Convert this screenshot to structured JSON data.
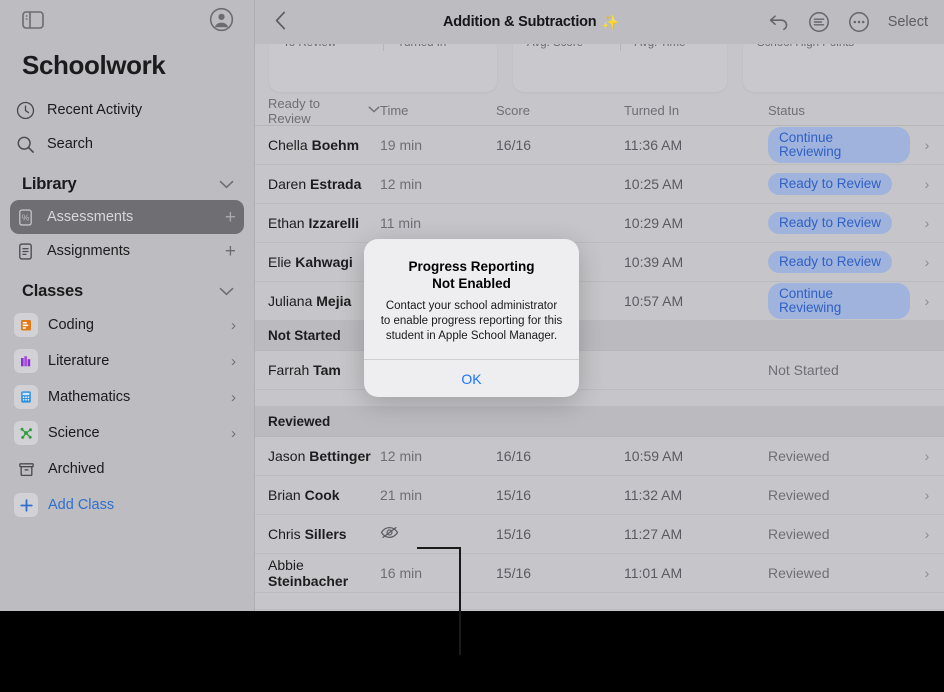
{
  "sidebar": {
    "toggle_icon": "sidebar-toggle-icon",
    "account_icon": "account-circle-icon",
    "app_title": "Schoolwork",
    "nav": [
      {
        "label": "Recent Activity",
        "icon": "clock-icon"
      },
      {
        "label": "Search",
        "icon": "search-icon"
      }
    ],
    "library": {
      "title": "Library",
      "items": [
        {
          "label": "Assessments",
          "icon": "assessments-icon",
          "selected": true,
          "add": "+"
        },
        {
          "label": "Assignments",
          "icon": "assignments-icon",
          "selected": false,
          "add": "+"
        }
      ]
    },
    "classes": {
      "title": "Classes",
      "items": [
        {
          "label": "Coding",
          "icon": "coding-icon",
          "chevron": "›"
        },
        {
          "label": "Literature",
          "icon": "literature-icon",
          "chevron": "›"
        },
        {
          "label": "Mathematics",
          "icon": "calculator-icon",
          "chevron": "›"
        },
        {
          "label": "Science",
          "icon": "molecule-icon",
          "chevron": "›"
        },
        {
          "label": "Archived",
          "icon": "archive-box-icon",
          "chevron": ""
        },
        {
          "label": "Add Class",
          "icon": "plus-icon",
          "chevron": ""
        }
      ]
    }
  },
  "toolbar": {
    "back_icon": "chevron-left-icon",
    "title": "Addition & Subtraction",
    "title_sparkle": "✨",
    "undo_icon": "undo-arrow-icon",
    "notes_icon": "text-lines-circle-icon",
    "more_icon": "ellipsis-circle-icon",
    "select_label": "Select"
  },
  "cards": [
    {
      "metrics": [
        "To Review",
        "Turned In"
      ]
    },
    {
      "metrics": [
        "Avg. Score",
        "Avg. Time"
      ]
    },
    {
      "metrics": [
        "School High Points"
      ]
    }
  ],
  "table": {
    "columns": {
      "name": "Ready to Review",
      "sort_chevron": "⌄",
      "time": "Time",
      "score": "Score",
      "turned_in": "Turned In",
      "status": "Status"
    },
    "rows": [
      {
        "first": "Chella ",
        "last": "Boehm",
        "time": "19 min",
        "score": "16/16",
        "turned_in": "11:36 AM",
        "status": "Continue Reviewing",
        "status_kind": "pill",
        "arrow": "›"
      },
      {
        "first": "Daren ",
        "last": "Estrada",
        "time": "12 min",
        "score": "",
        "turned_in": "10:25 AM",
        "status": "Ready to Review",
        "status_kind": "pill",
        "arrow": "›"
      },
      {
        "first": "Ethan ",
        "last": "Izzarelli",
        "time": "11 min",
        "score": "",
        "turned_in": "10:29 AM",
        "status": "Ready to Review",
        "status_kind": "pill",
        "arrow": "›"
      },
      {
        "first": "Elie ",
        "last": "Kahwagi",
        "time": "",
        "score": "",
        "turned_in": "10:39 AM",
        "status": "Ready to Review",
        "status_kind": "pill",
        "arrow": "›"
      },
      {
        "first": "Juliana ",
        "last": "Mejia",
        "time": "",
        "score": "",
        "turned_in": "10:57 AM",
        "status": "Continue Reviewing",
        "status_kind": "pill",
        "arrow": "›"
      }
    ],
    "section_not_started": {
      "title": "Not Started",
      "rows": [
        {
          "first": "Farrah ",
          "last": "Tam",
          "time": "",
          "score": "",
          "turned_in": "",
          "status": "Not Started",
          "status_kind": "text",
          "arrow": ""
        }
      ]
    },
    "section_reviewed": {
      "title": "Reviewed",
      "rows": [
        {
          "first": "Jason ",
          "last": "Bettinger",
          "time": "12 min",
          "score": "16/16",
          "turned_in": "10:59 AM",
          "status": "Reviewed",
          "status_kind": "text",
          "arrow": "›"
        },
        {
          "first": "Brian ",
          "last": "Cook",
          "time": "21 min",
          "score": "15/16",
          "turned_in": "11:32 AM",
          "status": "Reviewed",
          "status_kind": "text",
          "arrow": "›"
        },
        {
          "first": "Chris ",
          "last": "Sillers",
          "time": "",
          "time_icon": "eye-slash-icon",
          "score": "15/16",
          "turned_in": "11:27 AM",
          "status": "Reviewed",
          "status_kind": "text",
          "arrow": "›"
        },
        {
          "first": "Abbie ",
          "last": "Steinbacher",
          "time": "16 min",
          "score": "15/16",
          "turned_in": "11:01 AM",
          "status": "Reviewed",
          "status_kind": "text",
          "arrow": "›"
        }
      ]
    }
  },
  "alert": {
    "title_line1": "Progress Reporting",
    "title_line2": "Not Enabled",
    "message": "Contact your school administrator to enable progress reporting for this student in Apple School Manager.",
    "ok_label": "OK"
  },
  "colors": {
    "accent_blue": "#1a73ff",
    "pill_bg": "#9fb3dd",
    "pill_text": "#2f60c4",
    "sidebar_bg": "#bcbcc1",
    "main_bg": "#c6c6ca",
    "selected_row_bg": "#6f6f73"
  }
}
